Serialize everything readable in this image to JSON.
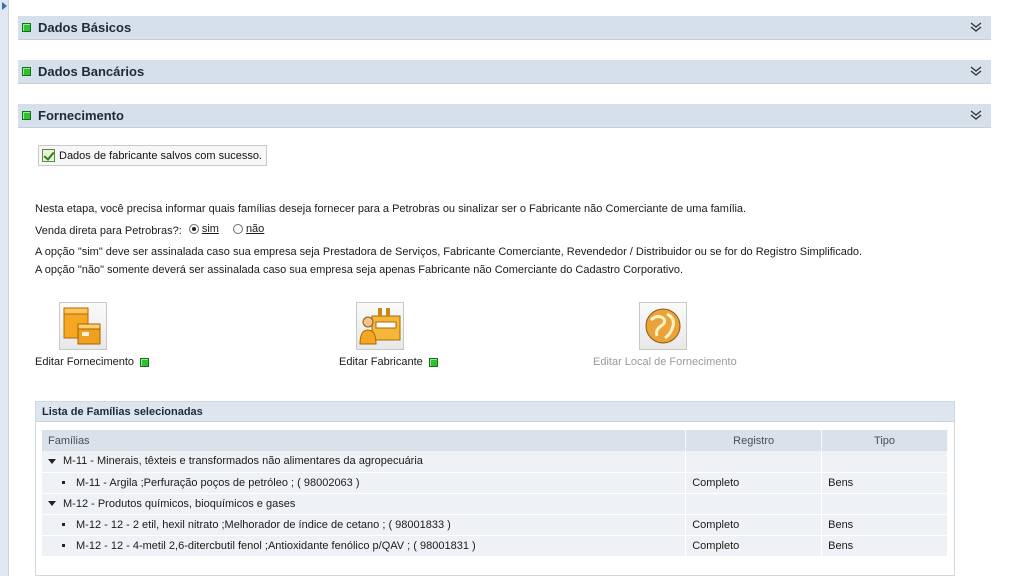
{
  "sections": [
    {
      "title": "Dados Básicos"
    },
    {
      "title": "Dados Bancários"
    },
    {
      "title": "Fornecimento"
    }
  ],
  "fornecimento": {
    "success_message": "Dados de fabricante salvos com sucesso.",
    "intro": "Nesta etapa, você precisa informar quais famílias deseja fornecer para a Petrobras ou sinalizar ser o Fabricante não Comerciante de uma família.",
    "venda_label": "Venda direta para Petrobras?:",
    "radio_sim": "sim",
    "radio_nao": "não",
    "radio_selected": "sim",
    "note_sim": "A opção \"sim\" deve ser assinalada caso sua empresa seja Prestadora de Serviços, Fabricante Comerciante, Revendedor / Distribuidor ou se for do Registro Simplificado.",
    "note_nao": "A opção \"não\" somente deverá ser assinalada caso sua empresa seja apenas Fabricante não Comerciante do Cadastro Corporativo.",
    "actions": [
      {
        "label": "Editar Fornecimento",
        "icon": "boxes-icon",
        "status": "complete"
      },
      {
        "label": "Editar Fabricante",
        "icon": "factory-person-icon",
        "status": "complete"
      },
      {
        "label": "Editar Local de Fornecimento",
        "icon": "globe-icon",
        "status": "disabled"
      }
    ]
  },
  "familias": {
    "title": "Lista de Famílias selecionadas",
    "columns": [
      "Famílias",
      "Registro",
      "Tipo"
    ],
    "rows": [
      {
        "level": 0,
        "text": "M-11 - Minerais, têxteis e transformados não alimentares da agropecuária",
        "registro": "",
        "tipo": ""
      },
      {
        "level": 1,
        "text": "M-11 - Argila ;Perfuração poços de petróleo ; ( 98002063 )",
        "registro": "Completo",
        "tipo": "Bens"
      },
      {
        "level": 0,
        "text": "M-12 - Produtos químicos, bioquímicos e gases",
        "registro": "",
        "tipo": ""
      },
      {
        "level": 1,
        "text": "M-12 - 12 - 2 etil, hexil nitrato ;Melhorador de índice de cetano ; ( 98001833 )",
        "registro": "Completo",
        "tipo": "Bens"
      },
      {
        "level": 1,
        "text": "M-12 - 12 - 4-metil 2,6-ditercbutil fenol ;Antioxidante fenólico p/QAV ; ( 98001831 )",
        "registro": "Completo",
        "tipo": "Bens"
      }
    ]
  },
  "colors": {
    "status_green": "#2fc22f",
    "header_bg": "#d6e0ea"
  }
}
